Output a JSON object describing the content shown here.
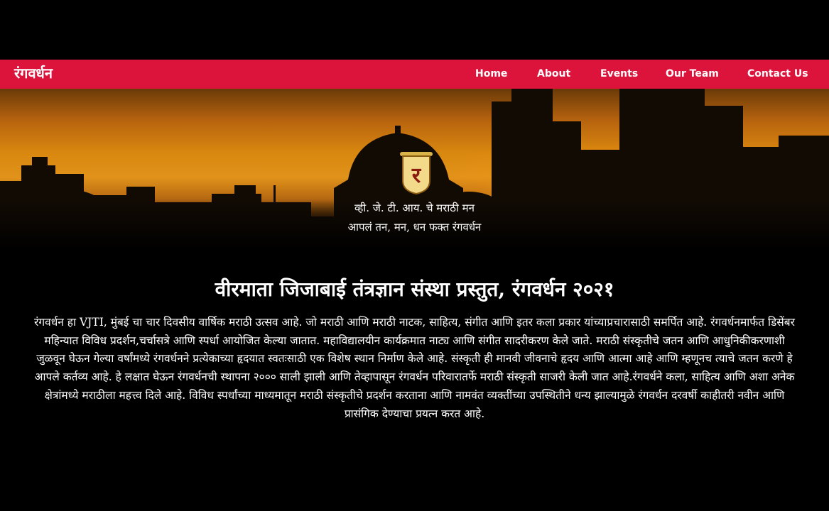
{
  "brand": "रंगवर्धन",
  "nav": [
    {
      "label": "Home"
    },
    {
      "label": "About"
    },
    {
      "label": "Events"
    },
    {
      "label": "Our Team"
    },
    {
      "label": "Contact Us"
    }
  ],
  "hero": {
    "emblem_icon": "rangvardhan-emblem-icon",
    "tagline_line1": "व्ही. जे. टी. आय. चे मराठी मन",
    "tagline_line2": "आपलं तन, मन, धन फक्त रंगवर्धन"
  },
  "main": {
    "heading": "वीरमाता जिजाबाई तंत्रज्ञान संस्था प्रस्तुत, रंगवर्धन २०२१",
    "paragraph": "रंगवर्धन हा VJTI, मुंबई चा चार दिवसीय वार्षिक मराठी उत्सव आहे. जो मराठी आणि मराठी नाटक, साहित्य, संगीत आणि इतर कला प्रकार यांच्याप्रचारासाठी समर्पित आहे. रंगवर्धनमार्फत डिसेंबर महिन्यात विविध प्रदर्शन,चर्चासत्रे आणि स्पर्धा आयोजित केल्या जातात. महाविद्यालयीन कार्यक्रमात नाट्य आणि संगीत सादरीकरण केले जाते. मराठी संस्कृतीचे जतन आणि आधुनिकीकरणाशी जुळवून घेऊन गेल्या वर्षांमध्ये रंगवर्धनने प्रत्येकाच्या हृदयात स्वतःसाठी एक विशेष स्थान निर्माण केले आहे. संस्कृती ही मानवी जीवनाचे हृदय आणि आत्मा आहे आणि म्हणूनच त्याचे जतन करणे हे आपले कर्तव्य आहे. हे लक्षात घेऊन रंगवर्धनची स्थापना २००० साली झाली आणि तेव्हापासून रंगवर्धन परिवारातर्फे मराठी संस्कृती साजरी केली जात आहे.रंगवर्धने कला, साहित्य आणि अशा अनेक क्षेत्रांमध्ये मराठीला महत्त्व दिले आहे. विविध स्पर्धांच्या माध्यमातून मराठी संस्कृतीचे प्रदर्शन करताना आणि नामवंत व्यक्तींच्या उपस्थितीने धन्य झाल्यामुळे रंगवर्धन दरवर्षी काहीतरी नवीन आणि प्रासंगिक देण्याचा प्रयत्न करत आहे."
  },
  "colors": {
    "navbar": "#dc143c",
    "background": "#000000",
    "text": "#ffffff"
  }
}
